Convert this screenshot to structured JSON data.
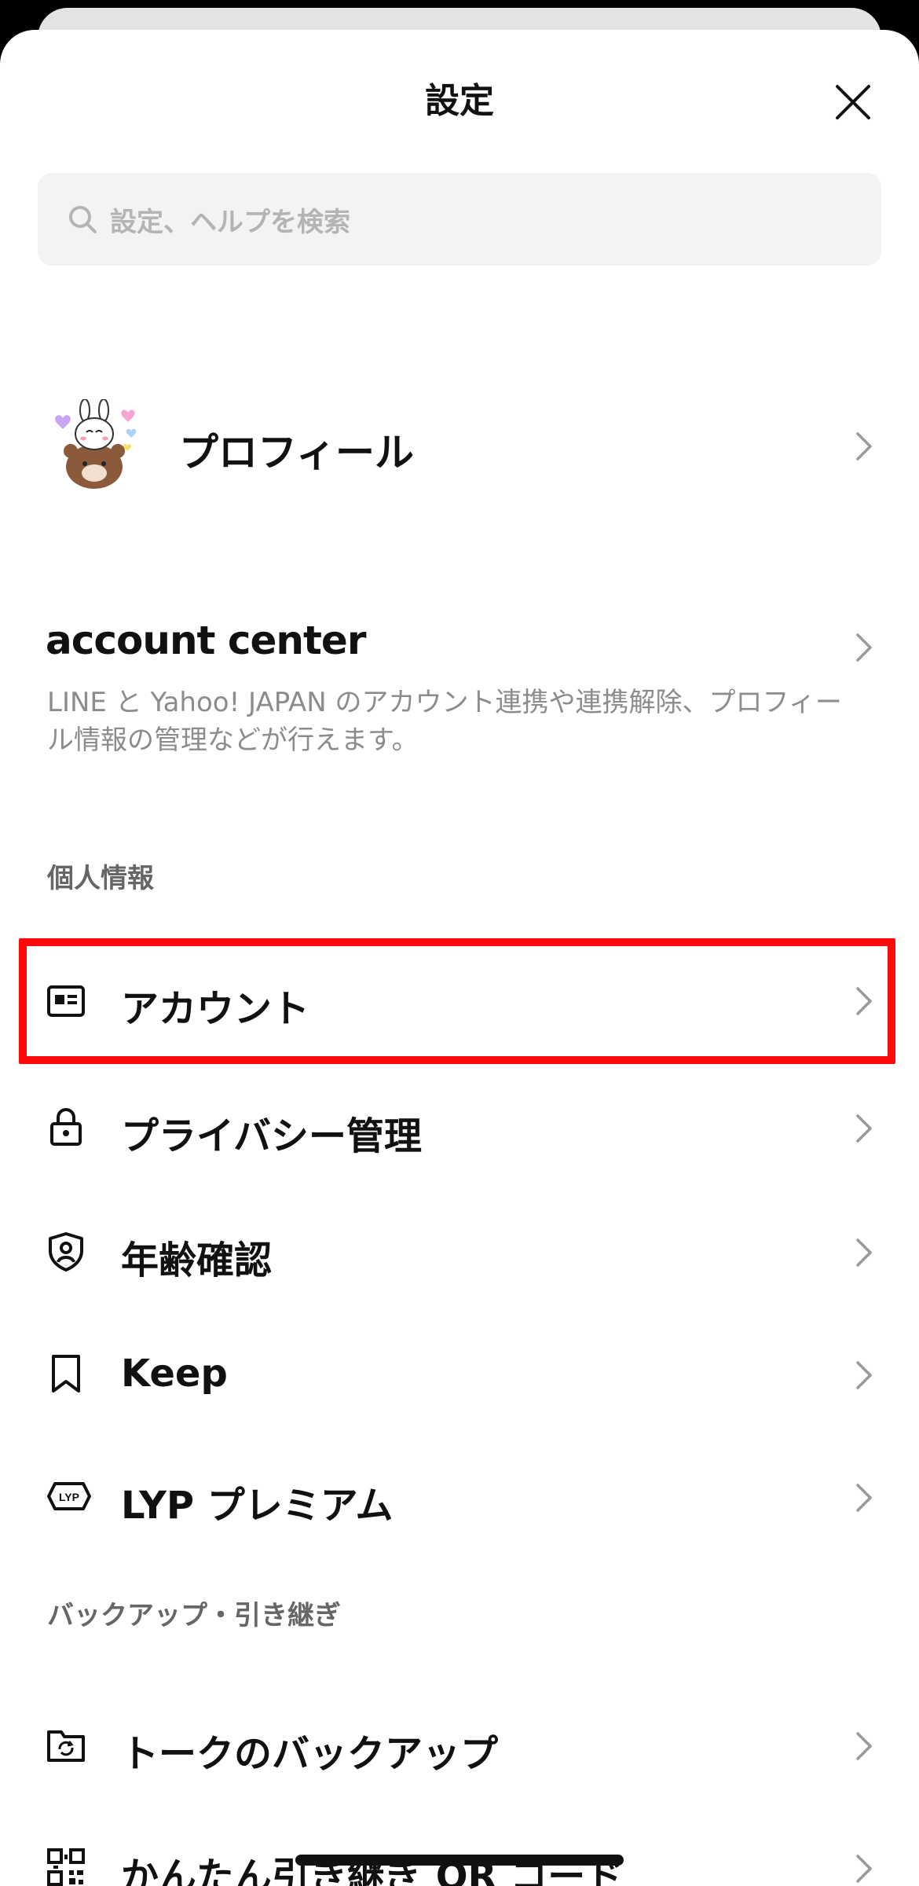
{
  "header": {
    "title": "設定",
    "close_icon": "close-icon"
  },
  "search": {
    "placeholder": "設定、ヘルプを検索",
    "icon": "search-icon"
  },
  "profile": {
    "label": "プロフィール",
    "avatar": "bear-rabbit-sticker-avatar"
  },
  "account_center": {
    "logo": "account center",
    "description": "LINE と Yahoo! JAPAN のアカウント連携や連携解除、プロフィール情報の管理などが行えます。"
  },
  "sections": [
    {
      "header": "個人情報",
      "items": [
        {
          "label": "アカウント",
          "icon": "id-card-icon",
          "highlighted": true
        },
        {
          "label": "プライバシー管理",
          "icon": "lock-icon"
        },
        {
          "label": "年齢確認",
          "icon": "shield-user-icon"
        },
        {
          "label": "Keep",
          "icon": "bookmark-icon"
        },
        {
          "label": "LYP プレミアム",
          "icon": "lyp-badge-icon"
        }
      ]
    },
    {
      "header": "バックアップ・引き継ぎ",
      "items": [
        {
          "label": "トークのバックアップ",
          "icon": "folder-sync-icon"
        },
        {
          "label": "かんたん引き継ぎ QR コード",
          "icon": "qr-code-icon"
        }
      ]
    }
  ],
  "colors": {
    "highlight": "#ff0a0a",
    "search_bg": "#f3f3f3",
    "section_header": "#666666",
    "muted_text": "#8c8c8c"
  }
}
